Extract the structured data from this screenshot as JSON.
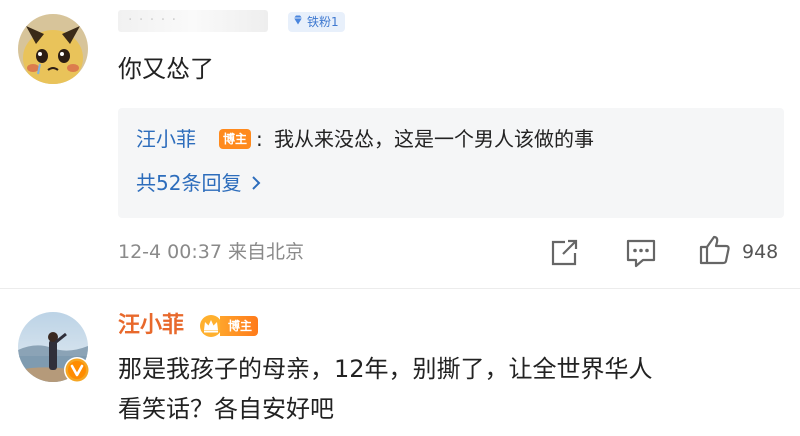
{
  "comment1": {
    "username_redacted": "· · · · ·",
    "fan_badge": "铁粉1",
    "text": "你又怂了",
    "reply": {
      "author": "汪小菲",
      "author_badge": "博主",
      "colon": ":",
      "text": "我从来没怂，这是一个男人该做的事",
      "count_label": "共52条回复"
    },
    "meta": "12-4 00:37 来自北京",
    "like_count": "948"
  },
  "comment2": {
    "username": "汪小菲",
    "author_badge": "博主",
    "text_line1": "那是我孩子的母亲，12年，别撕了，让全世界华人",
    "text_line2": "看笑话？各自安好吧"
  },
  "colors": {
    "link_blue": "#2d6dbc",
    "author_orange": "#e8692c",
    "badge_orange": "#ff8a1d",
    "meta_gray": "#8a8a8a"
  },
  "icons": {
    "fan_badge": "diamond-icon",
    "reply_more": "chevron-right-icon",
    "share": "share-icon",
    "comment": "comment-icon",
    "like": "thumbs-up-icon",
    "verified": "verified-v-icon",
    "author_crown": "crown-icon"
  }
}
